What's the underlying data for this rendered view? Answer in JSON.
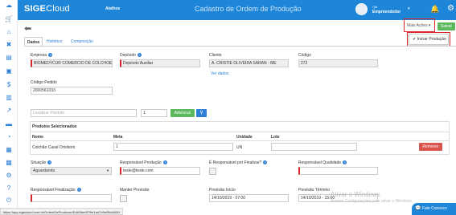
{
  "app": {
    "logo_text": "SIGE",
    "logo_cloud": "Cloud",
    "atalhos": "Atalhos",
    "page_title": "Cadastro de Ordem de Produção",
    "user_name": "Olá",
    "user_role": "Empreendedor"
  },
  "toolbar": {
    "mais_acoes": "Mais Ações",
    "salvar": "Salvar",
    "menu_items": [
      "Iniciar Produção"
    ]
  },
  "tabs": [
    "Dados",
    "Histórico",
    "Composição"
  ],
  "form": {
    "empresa": {
      "label": "Empresa",
      "value": "BIOMEDYCUR COMERCIO DE COLCHOE"
    },
    "deposito": {
      "label": "Depósito",
      "value": "Depósito Auxiliar"
    },
    "cliente": {
      "label": "Cliente",
      "value": "A. CRISTIE OLIVEIRA SARAN - ME",
      "link": "Ver dados"
    },
    "codigo": {
      "label": "Código",
      "value": "272"
    },
    "codigo_pedido": {
      "label": "Código Pedido",
      "value": "2000561033"
    },
    "localizar_produto": {
      "placeholder": "Localizar Produto",
      "quantity": "1"
    },
    "adicionar": "Adicionar"
  },
  "table": {
    "title": "Produtos Selecionados",
    "headers": [
      "Nome",
      "Meta",
      "Unidade",
      "Lote"
    ],
    "rows": [
      {
        "nome": "Colchão Casal Ortobom",
        "meta": "1",
        "unidade": "UN",
        "lote": "",
        "action": "Remover"
      }
    ]
  },
  "footer_fields": {
    "situacao": {
      "label": "Situação",
      "value": "Aguardando"
    },
    "resp_producao": {
      "label": "Responsável Produção",
      "value": "teste@teste.com"
    },
    "e_resp_finalizar": {
      "label": "É Responsável por Finalizar?"
    },
    "resp_qualidade": {
      "label": "Responsável Qualidade"
    },
    "resp_finalizacao": {
      "label": "Responsável Finalização"
    },
    "manter_previsao": {
      "label": "Manter Previsão"
    },
    "previsao_inicio": {
      "label": "Previsão Início",
      "value": "14/10/2019 - 07:00"
    },
    "previsao_termino": {
      "label": "Previsão Término",
      "value": "14/10/2019 - 15:00"
    }
  },
  "status_bar": {
    "url": "https://app.sigecloud.com.br/OrdemDeProducao/Edit/5de6f79fe1ad7d9e08d4464f"
  },
  "watermark": {
    "line1": "Ativar o Windows",
    "line2": "Acesse Configurações para ativar o Windows."
  },
  "chat": {
    "label": "Fale Conosco"
  },
  "colors": {
    "brand_blue": "#1e86d8",
    "success": "#5cb85c",
    "danger": "#d9534f",
    "highlight": "#d9262c"
  }
}
